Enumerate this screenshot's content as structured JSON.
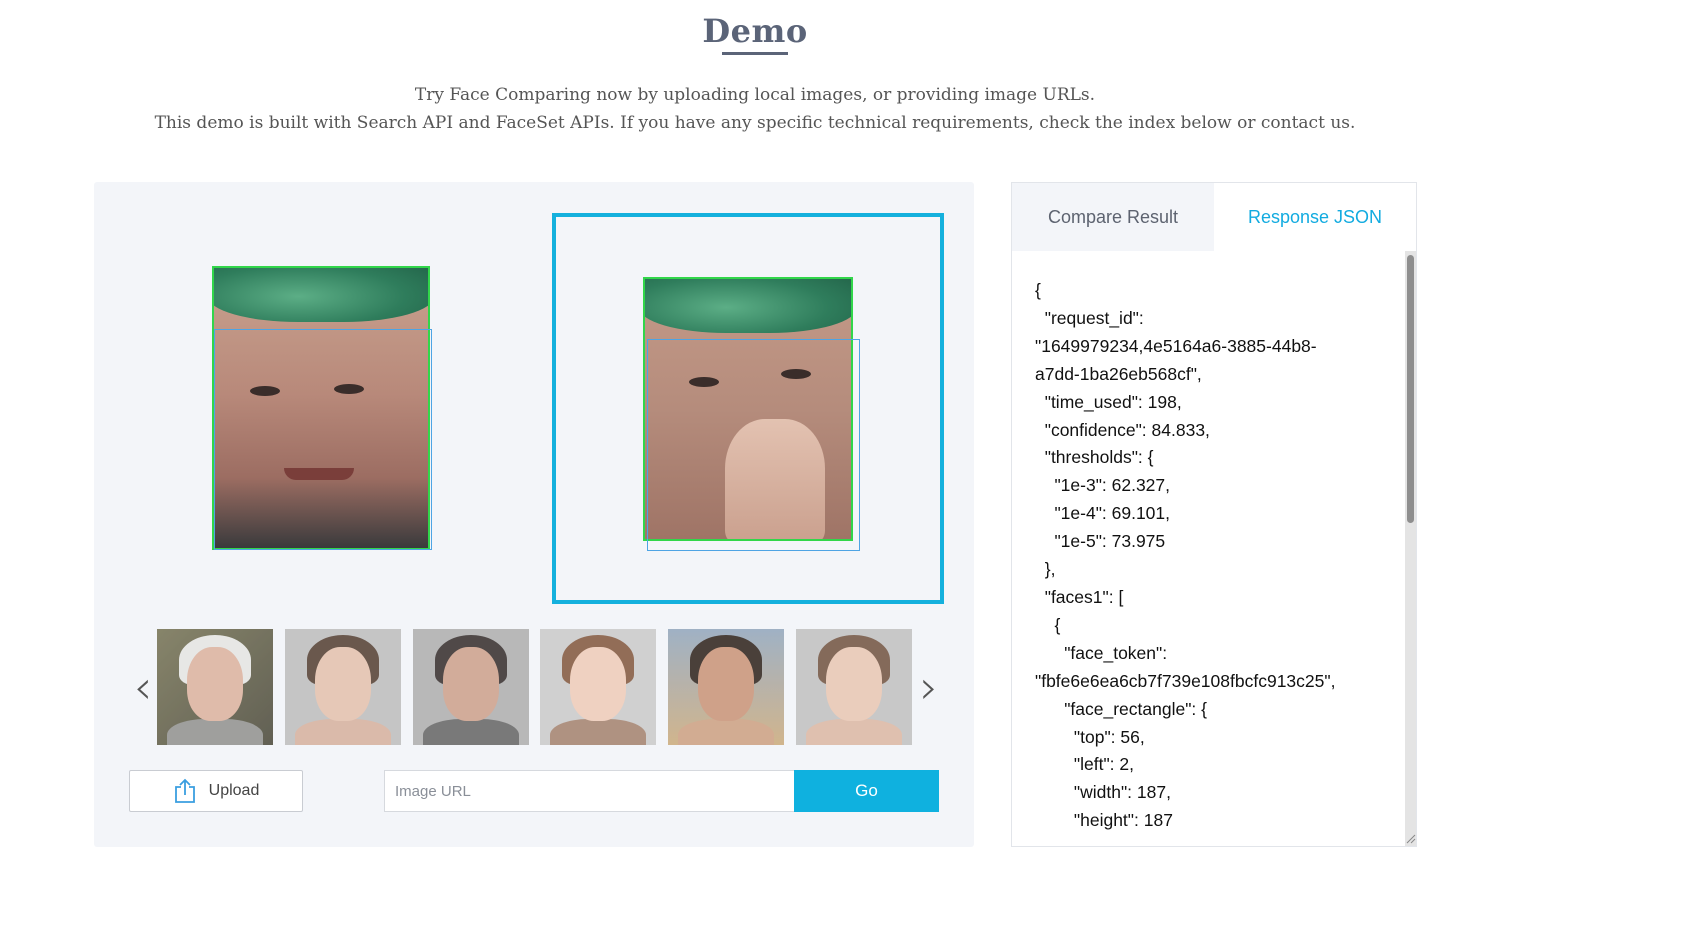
{
  "header": {
    "title": "Demo",
    "line1": "Try Face Comparing now by uploading local images, or providing image URLs.",
    "line2": "This demo is built with Search API and FaceSet APIs. If you have any specific technical requirements, check the index below or contact us."
  },
  "carousel": {
    "prev_icon": "chevron-left-icon",
    "next_icon": "chevron-right-icon",
    "thumbnails": [
      "elderly-man-glasses",
      "woman-hair-bun",
      "man-glasses-beard",
      "girl-smiling",
      "woman-curly-hair",
      "woman-hand-face"
    ]
  },
  "controls": {
    "upload_label": "Upload",
    "upload_icon": "upload-icon",
    "url_placeholder": "Image URL",
    "url_value": "",
    "go_label": "Go"
  },
  "results": {
    "tabs": [
      {
        "label": "Compare Result",
        "active": false
      },
      {
        "label": "Response JSON",
        "active": true
      }
    ],
    "json_lines": [
      "{",
      "  \"request_id\":",
      "\"1649979234,4e5164a6-3885-44b8-",
      "a7dd-1ba26eb568cf\",",
      "  \"time_used\": 198,",
      "  \"confidence\": 84.833,",
      "  \"thresholds\": {",
      "    \"1e-3\": 62.327,",
      "    \"1e-4\": 69.101,",
      "    \"1e-5\": 73.975",
      "  },",
      "  \"faces1\": [",
      "    {",
      "      \"face_token\":",
      "\"fbfe6e6ea6cb7f739e108fbcfc913c25\",",
      "      \"face_rectangle\": {",
      "        \"top\": 56,",
      "        \"left\": 2,",
      "        \"width\": 187,",
      "        \"height\": 187"
    ]
  },
  "colors": {
    "accent": "#14b0dd",
    "face_box": "#31d64a",
    "detect_box": "#4ea4e4",
    "panel_bg": "#f3f5f9"
  }
}
